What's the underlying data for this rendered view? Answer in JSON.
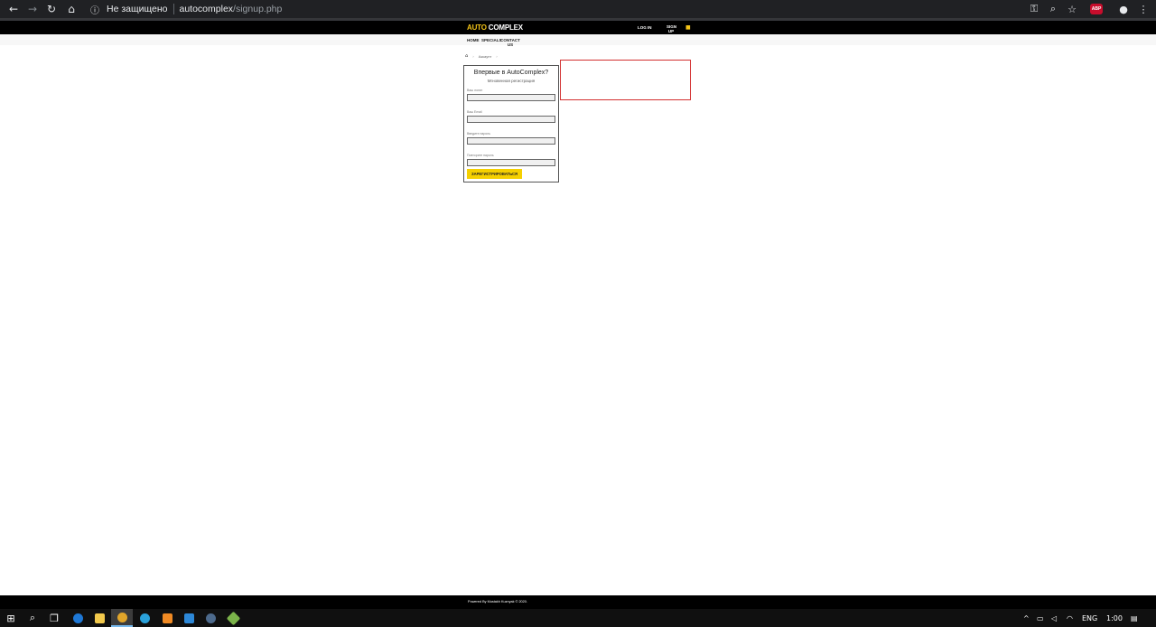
{
  "browser": {
    "security_label": "Не защищено",
    "url_host": "autocomplex",
    "url_path": "/signup.php",
    "abp_label": "ABP"
  },
  "site": {
    "logo_auto": "AUTO",
    "logo_complex": "COMPLEX",
    "login_label": "LOG IN",
    "signup_label": "SIGN UP",
    "nav": {
      "home": "HOME",
      "specials": "SPECIALS",
      "contact": "CONTACT US"
    },
    "breadcrumb_current": "Аккаунт"
  },
  "form": {
    "title": "Впервые в AutoComplex?",
    "subtitle": "Мгновенная регистрация",
    "fields": [
      {
        "label": "Ваш логин",
        "value": ""
      },
      {
        "label": "Ваш Email",
        "value": ""
      },
      {
        "label": "Введите пароль",
        "value": ""
      },
      {
        "label": "Повторите пароль",
        "value": ""
      }
    ],
    "submit_label": "ЗАРЕГИСТРИРОВАТЬСЯ"
  },
  "footer": {
    "text": "Powered By Mustakh Kuznyak © 2020."
  },
  "taskbar": {
    "lang": "ENG",
    "time": "1:00"
  },
  "colors": {
    "brand_yellow": "#f5c518",
    "button_yellow": "#f5d000",
    "error_border": "#d32f2f"
  }
}
